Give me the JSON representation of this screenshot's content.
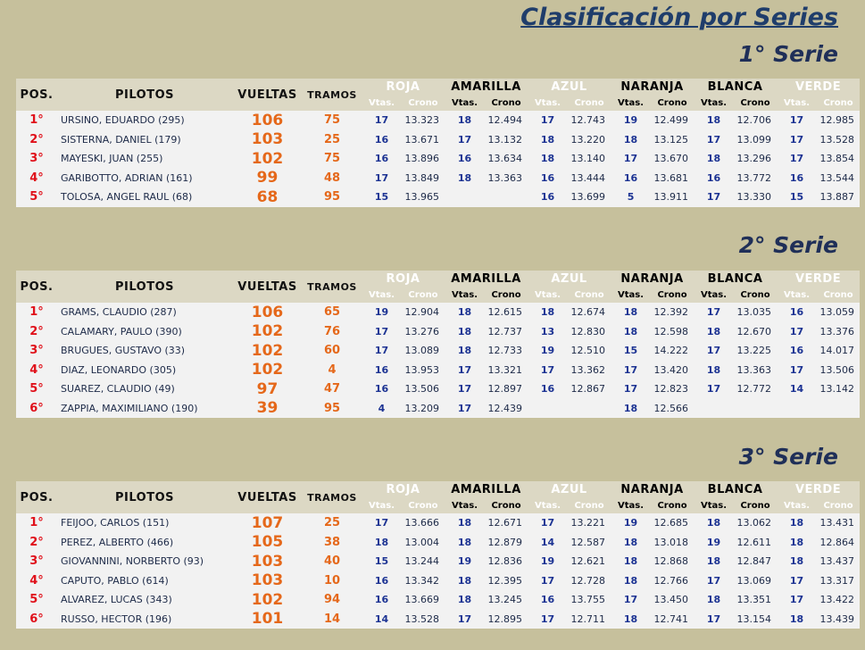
{
  "title": "Clasificación por Series",
  "headers": {
    "pos": "POS.",
    "pilotos": "PILOTOS",
    "vueltas": "VUELTAS",
    "tramos": "TRAMOS",
    "vtas": "Vtas.",
    "crono": "Crono"
  },
  "colors": [
    {
      "key": "roja",
      "name": "ROJA",
      "bg": "#ec1c24",
      "fg": "#ffffff"
    },
    {
      "key": "amarilla",
      "name": "AMARILLA",
      "bg": "#ffff00",
      "fg": "#000000"
    },
    {
      "key": "azul",
      "name": "AZUL",
      "bg": "#0f1fd9",
      "fg": "#ffffff"
    },
    {
      "key": "naranja",
      "name": "NARANJA",
      "bg": "#f47a20",
      "fg": "#000000"
    },
    {
      "key": "blanca",
      "name": "BLANCA",
      "bg": "#ffffff",
      "fg": "#000000"
    },
    {
      "key": "verde",
      "name": "VERDE",
      "bg": "#1b9b34",
      "fg": "#ffffff"
    }
  ],
  "series": [
    {
      "title": "1° Serie",
      "rows": [
        {
          "pos": "1°",
          "piloto": "URSINO, EDUARDO (295)",
          "vueltas": "106",
          "tramos": "75",
          "lanes": [
            [
              "17",
              "13.323"
            ],
            [
              "18",
              "12.494"
            ],
            [
              "17",
              "12.743"
            ],
            [
              "19",
              "12.499"
            ],
            [
              "18",
              "12.706"
            ],
            [
              "17",
              "12.985"
            ]
          ]
        },
        {
          "pos": "2°",
          "piloto": "SISTERNA, DANIEL (179)",
          "vueltas": "103",
          "tramos": "25",
          "lanes": [
            [
              "16",
              "13.671"
            ],
            [
              "17",
              "13.132"
            ],
            [
              "18",
              "13.220"
            ],
            [
              "18",
              "13.125"
            ],
            [
              "17",
              "13.099"
            ],
            [
              "17",
              "13.528"
            ]
          ]
        },
        {
          "pos": "3°",
          "piloto": "MAYESKI, JUAN (255)",
          "vueltas": "102",
          "tramos": "75",
          "lanes": [
            [
              "16",
              "13.896"
            ],
            [
              "16",
              "13.634"
            ],
            [
              "18",
              "13.140"
            ],
            [
              "17",
              "13.670"
            ],
            [
              "18",
              "13.296"
            ],
            [
              "17",
              "13.854"
            ]
          ]
        },
        {
          "pos": "4°",
          "piloto": "GARIBOTTO, ADRIAN (161)",
          "vueltas": "99",
          "tramos": "48",
          "lanes": [
            [
              "17",
              "13.849"
            ],
            [
              "18",
              "13.363"
            ],
            [
              "16",
              "13.444"
            ],
            [
              "16",
              "13.681"
            ],
            [
              "16",
              "13.772"
            ],
            [
              "16",
              "13.544"
            ]
          ]
        },
        {
          "pos": "5°",
          "piloto": "TOLOSA, ANGEL RAUL (68)",
          "vueltas": "68",
          "tramos": "95",
          "lanes": [
            [
              "15",
              "13.965"
            ],
            [
              "",
              ""
            ],
            [
              "16",
              "13.699"
            ],
            [
              "5",
              "13.911"
            ],
            [
              "17",
              "13.330"
            ],
            [
              "15",
              "13.887"
            ]
          ]
        }
      ]
    },
    {
      "title": "2° Serie",
      "rows": [
        {
          "pos": "1°",
          "piloto": "GRAMS, CLAUDIO (287)",
          "vueltas": "106",
          "tramos": "65",
          "lanes": [
            [
              "19",
              "12.904"
            ],
            [
              "18",
              "12.615"
            ],
            [
              "18",
              "12.674"
            ],
            [
              "18",
              "12.392"
            ],
            [
              "17",
              "13.035"
            ],
            [
              "16",
              "13.059"
            ]
          ]
        },
        {
          "pos": "2°",
          "piloto": "CALAMARY, PAULO (390)",
          "vueltas": "102",
          "tramos": "76",
          "lanes": [
            [
              "17",
              "13.276"
            ],
            [
              "18",
              "12.737"
            ],
            [
              "13",
              "12.830"
            ],
            [
              "18",
              "12.598"
            ],
            [
              "18",
              "12.670"
            ],
            [
              "17",
              "13.376"
            ]
          ]
        },
        {
          "pos": "3°",
          "piloto": "BRUGUES, GUSTAVO (33)",
          "vueltas": "102",
          "tramos": "60",
          "lanes": [
            [
              "17",
              "13.089"
            ],
            [
              "18",
              "12.733"
            ],
            [
              "19",
              "12.510"
            ],
            [
              "15",
              "14.222"
            ],
            [
              "17",
              "13.225"
            ],
            [
              "16",
              "14.017"
            ]
          ]
        },
        {
          "pos": "4°",
          "piloto": "DIAZ, LEONARDO (305)",
          "vueltas": "102",
          "tramos": "4",
          "lanes": [
            [
              "16",
              "13.953"
            ],
            [
              "17",
              "13.321"
            ],
            [
              "17",
              "13.362"
            ],
            [
              "17",
              "13.420"
            ],
            [
              "18",
              "13.363"
            ],
            [
              "17",
              "13.506"
            ]
          ]
        },
        {
          "pos": "5°",
          "piloto": "SUAREZ, CLAUDIO (49)",
          "vueltas": "97",
          "tramos": "47",
          "lanes": [
            [
              "16",
              "13.506"
            ],
            [
              "17",
              "12.897"
            ],
            [
              "16",
              "12.867"
            ],
            [
              "17",
              "12.823"
            ],
            [
              "17",
              "12.772"
            ],
            [
              "14",
              "13.142"
            ]
          ]
        },
        {
          "pos": "6°",
          "piloto": "ZAPPIA, MAXIMILIANO (190)",
          "vueltas": "39",
          "tramos": "95",
          "lanes": [
            [
              "4",
              "13.209"
            ],
            [
              "17",
              "12.439"
            ],
            [
              "",
              ""
            ],
            [
              "18",
              "12.566"
            ],
            [
              "",
              ""
            ],
            [
              "",
              ""
            ]
          ]
        }
      ]
    },
    {
      "title": "3° Serie",
      "rows": [
        {
          "pos": "1°",
          "piloto": "FEIJOO, CARLOS (151)",
          "vueltas": "107",
          "tramos": "25",
          "lanes": [
            [
              "17",
              "13.666"
            ],
            [
              "18",
              "12.671"
            ],
            [
              "17",
              "13.221"
            ],
            [
              "19",
              "12.685"
            ],
            [
              "18",
              "13.062"
            ],
            [
              "18",
              "13.431"
            ]
          ]
        },
        {
          "pos": "2°",
          "piloto": "PEREZ, ALBERTO (466)",
          "vueltas": "105",
          "tramos": "38",
          "lanes": [
            [
              "18",
              "13.004"
            ],
            [
              "18",
              "12.879"
            ],
            [
              "14",
              "12.587"
            ],
            [
              "18",
              "13.018"
            ],
            [
              "19",
              "12.611"
            ],
            [
              "18",
              "12.864"
            ]
          ]
        },
        {
          "pos": "3°",
          "piloto": "GIOVANNINI, NORBERTO (93)",
          "vueltas": "103",
          "tramos": "40",
          "lanes": [
            [
              "15",
              "13.244"
            ],
            [
              "19",
              "12.836"
            ],
            [
              "19",
              "12.621"
            ],
            [
              "18",
              "12.868"
            ],
            [
              "18",
              "12.847"
            ],
            [
              "18",
              "13.437"
            ]
          ]
        },
        {
          "pos": "4°",
          "piloto": "CAPUTO, PABLO (614)",
          "vueltas": "103",
          "tramos": "10",
          "lanes": [
            [
              "16",
              "13.342"
            ],
            [
              "18",
              "12.395"
            ],
            [
              "17",
              "12.728"
            ],
            [
              "18",
              "12.766"
            ],
            [
              "17",
              "13.069"
            ],
            [
              "17",
              "13.317"
            ]
          ]
        },
        {
          "pos": "5°",
          "piloto": "ALVAREZ, LUCAS (343)",
          "vueltas": "102",
          "tramos": "94",
          "lanes": [
            [
              "16",
              "13.669"
            ],
            [
              "18",
              "13.245"
            ],
            [
              "16",
              "13.755"
            ],
            [
              "17",
              "13.450"
            ],
            [
              "18",
              "13.351"
            ],
            [
              "17",
              "13.422"
            ]
          ]
        },
        {
          "pos": "6°",
          "piloto": "RUSSO, HECTOR (196)",
          "vueltas": "101",
          "tramos": "14",
          "lanes": [
            [
              "14",
              "13.528"
            ],
            [
              "17",
              "12.895"
            ],
            [
              "17",
              "12.711"
            ],
            [
              "18",
              "12.741"
            ],
            [
              "17",
              "13.154"
            ],
            [
              "18",
              "13.439"
            ]
          ]
        }
      ]
    }
  ]
}
